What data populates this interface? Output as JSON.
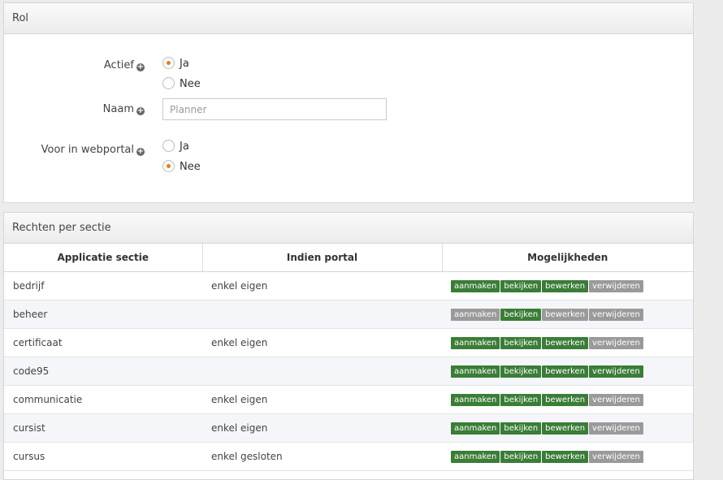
{
  "role_panel": {
    "title": "Rol",
    "actief": {
      "label": "Actief",
      "options": [
        {
          "label": "Ja",
          "checked": true
        },
        {
          "label": "Nee",
          "checked": false
        }
      ]
    },
    "naam": {
      "label": "Naam",
      "placeholder": "Planner",
      "value": ""
    },
    "webportal": {
      "label": "Voor in webportal",
      "options": [
        {
          "label": "Ja",
          "checked": false
        },
        {
          "label": "Nee",
          "checked": true
        }
      ]
    }
  },
  "rights_panel": {
    "title": "Rechten per sectie",
    "columns": [
      "Applicatie sectie",
      "Indien portal",
      "Mogelijkheden"
    ],
    "permission_labels": [
      "aanmaken",
      "bekijken",
      "bewerken",
      "verwijderen"
    ],
    "colors": {
      "enabled": "#3a7d37",
      "disabled": "#9a9a9a",
      "radio_accent": "#e87c1e"
    },
    "rows": [
      {
        "section": "bedrijf",
        "portal": "enkel eigen",
        "perms": [
          true,
          true,
          true,
          false
        ]
      },
      {
        "section": "beheer",
        "portal": "",
        "perms": [
          false,
          true,
          false,
          false
        ]
      },
      {
        "section": "certificaat",
        "portal": "enkel eigen",
        "perms": [
          true,
          true,
          true,
          false
        ]
      },
      {
        "section": "code95",
        "portal": "",
        "perms": [
          true,
          true,
          true,
          true
        ]
      },
      {
        "section": "communicatie",
        "portal": "enkel eigen",
        "perms": [
          true,
          true,
          true,
          false
        ]
      },
      {
        "section": "cursist",
        "portal": "enkel eigen",
        "perms": [
          true,
          true,
          true,
          false
        ]
      },
      {
        "section": "cursus",
        "portal": "enkel gesloten",
        "perms": [
          true,
          true,
          true,
          false
        ]
      }
    ]
  }
}
